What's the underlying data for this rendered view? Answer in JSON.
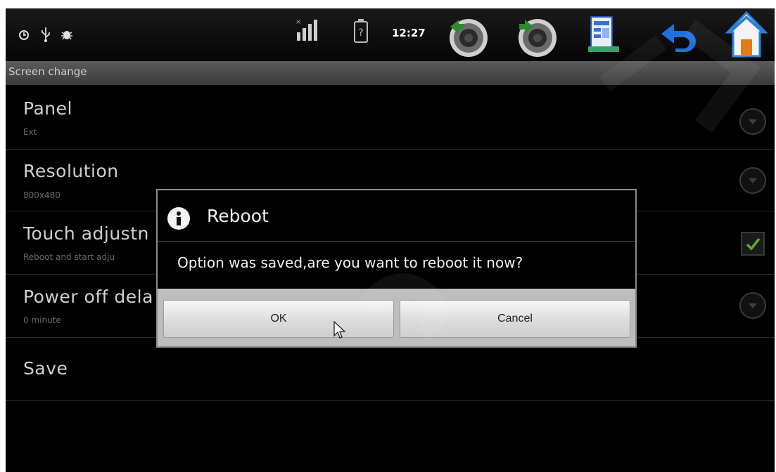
{
  "status_bar": {
    "time": "12:27",
    "icons": [
      "alarm-icon",
      "usb-icon",
      "debug-icon",
      "signal-icon",
      "battery-icon",
      "volume-down-icon",
      "volume-up-icon",
      "menu-icon",
      "back-icon",
      "home-icon"
    ]
  },
  "screen_title": "Screen change",
  "settings": [
    {
      "title": "Panel",
      "subtitle": "Ext",
      "control": "dropdown"
    },
    {
      "title": "Resolution",
      "subtitle": "800x480",
      "control": "dropdown"
    },
    {
      "title": "Touch adjustn",
      "subtitle": "Reboot and start adju",
      "control": "checkbox",
      "checked": true
    },
    {
      "title": "Power off dela",
      "subtitle": "0 minute",
      "control": "dropdown"
    },
    {
      "title": "Save",
      "subtitle": "",
      "control": "none"
    }
  ],
  "dialog": {
    "title": "Reboot",
    "icon": "info-icon",
    "message": "Option was saved,are you want to reboot it now?",
    "ok_label": "OK",
    "cancel_label": "Cancel"
  },
  "colors": {
    "background": "#000000",
    "accent_check": "#5fae2a",
    "title_bar": "#4a4a4a"
  }
}
